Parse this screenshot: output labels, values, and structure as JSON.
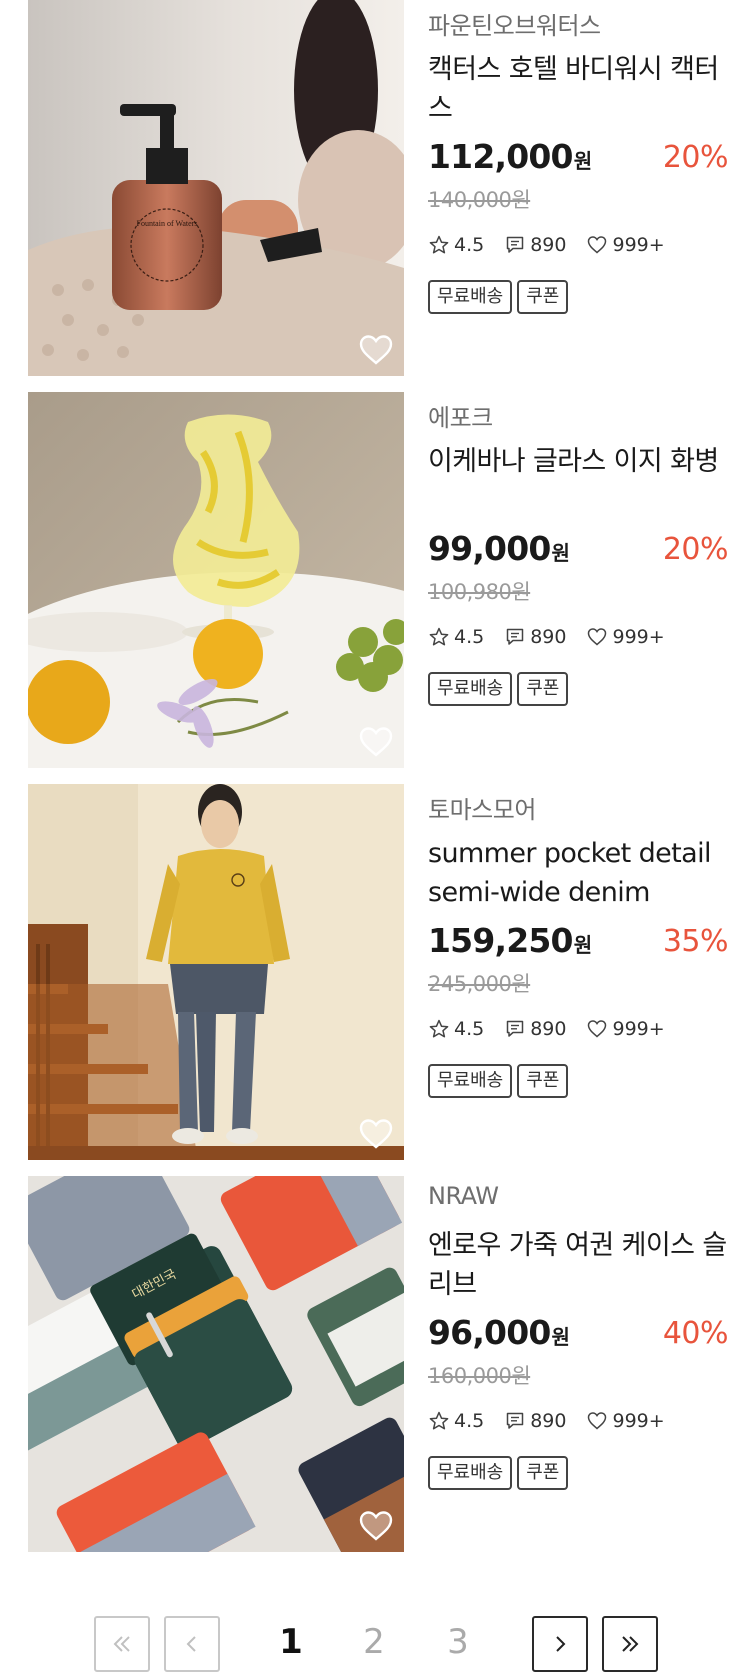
{
  "products": [
    {
      "brand": "파운틴오브워터스",
      "name": "캑터스 호텔 바디워시 캑터스",
      "price": "112,000",
      "currency": "원",
      "discount": "20%",
      "original_price": "140,000원",
      "rating": "4.5",
      "reviews": "890",
      "likes": "999+",
      "tags": [
        "무료배송",
        "쿠폰"
      ]
    },
    {
      "brand": "에포크",
      "name": "이케바나 글라스 이지 화병",
      "price": "99,000",
      "currency": "원",
      "discount": "20%",
      "original_price": "100,980원",
      "rating": "4.5",
      "reviews": "890",
      "likes": "999+",
      "tags": [
        "무료배송",
        "쿠폰"
      ]
    },
    {
      "brand": "토마스모어",
      "name": "summer pocket detail semi-wide denim",
      "price": "159,250",
      "currency": "원",
      "discount": "35%",
      "original_price": "245,000원",
      "rating": "4.5",
      "reviews": "890",
      "likes": "999+",
      "tags": [
        "무료배송",
        "쿠폰"
      ]
    },
    {
      "brand": "NRAW",
      "name": "엔로우 가죽 여권 케이스 슬리브",
      "price": "96,000",
      "currency": "원",
      "discount": "40%",
      "original_price": "160,000원",
      "rating": "4.5",
      "reviews": "890",
      "likes": "999+",
      "tags": [
        "무료배송",
        "쿠폰"
      ]
    }
  ],
  "product_images": [
    {
      "text": "Fountain of Waters"
    },
    {},
    {},
    {
      "text": "대한민국"
    }
  ],
  "pagination": {
    "pages": [
      "1",
      "2",
      "3"
    ],
    "current": "1"
  },
  "colors": {
    "discount": "#e8543c",
    "brand_text": "#6e6e6e",
    "original_price": "#9a9a9a"
  }
}
